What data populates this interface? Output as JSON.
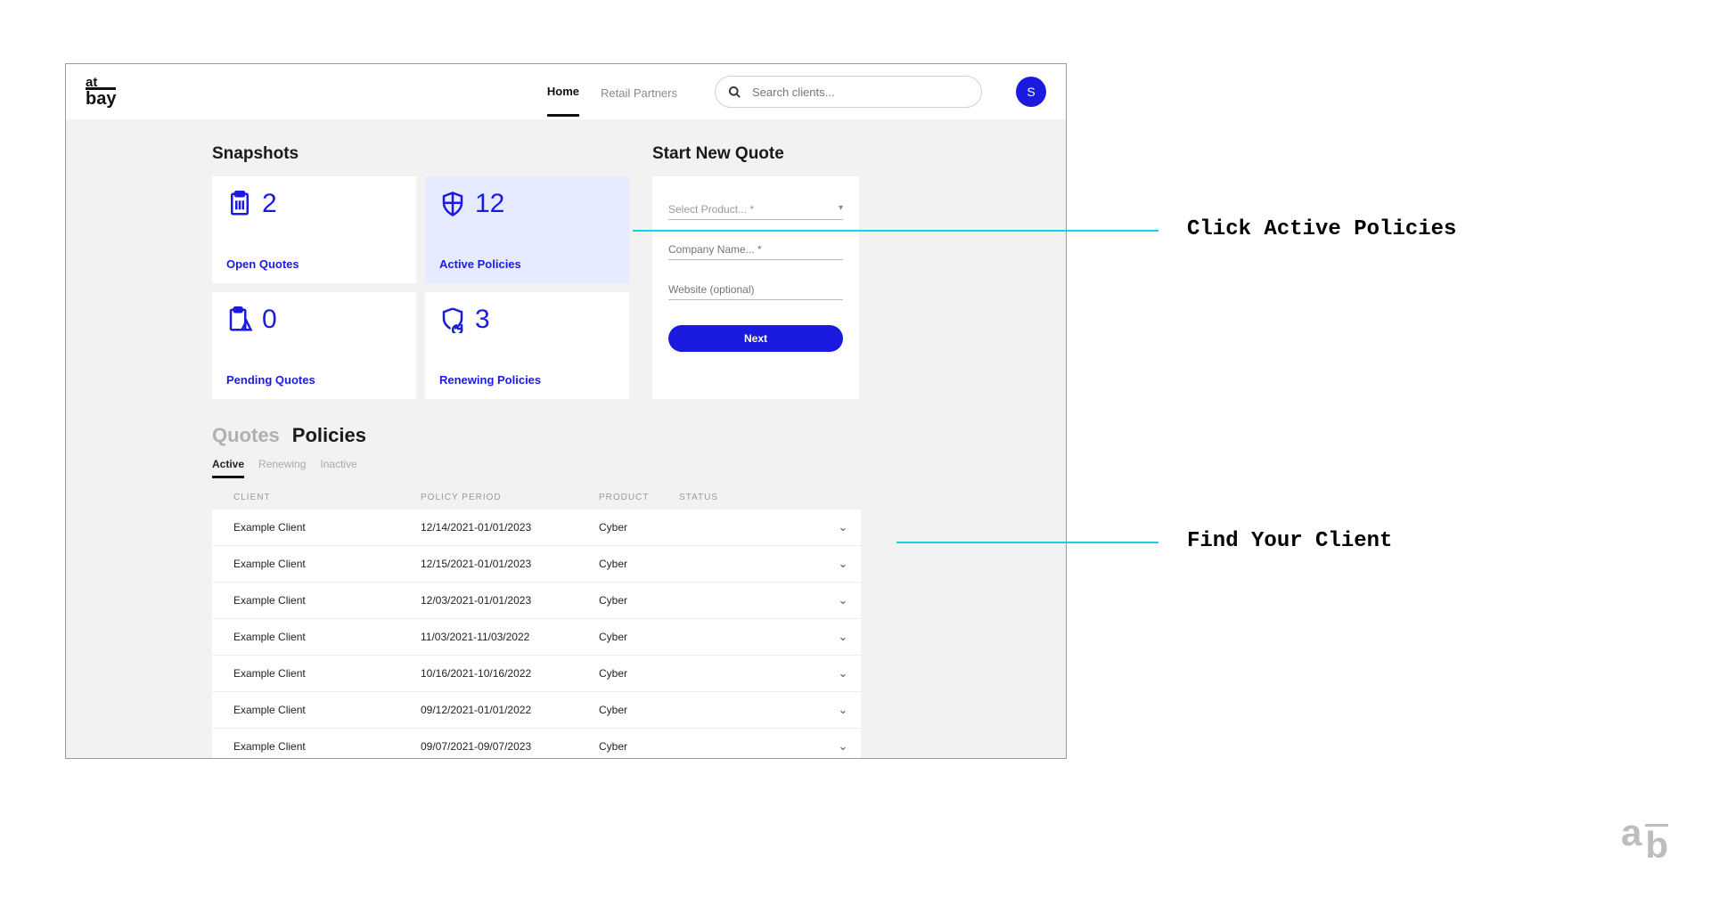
{
  "logo": {
    "top": "at",
    "bottom": "bay"
  },
  "nav": {
    "home": "Home",
    "retail": "Retail Partners"
  },
  "search": {
    "placeholder": "Search clients..."
  },
  "avatar": {
    "initial": "S"
  },
  "snapshots": {
    "title": "Snapshots",
    "cards": [
      {
        "count": "2",
        "label": "Open Quotes"
      },
      {
        "count": "12",
        "label": "Active Policies"
      },
      {
        "count": "0",
        "label": "Pending Quotes"
      },
      {
        "count": "3",
        "label": "Renewing Policies"
      }
    ]
  },
  "newquote": {
    "title": "Start New Quote",
    "product_placeholder": "Select Product... *",
    "company_placeholder": "Company Name... *",
    "website_placeholder": "Website (optional)",
    "next": "Next"
  },
  "maintabs": {
    "quotes": "Quotes",
    "policies": "Policies"
  },
  "subtabs": {
    "active": "Active",
    "renewing": "Renewing",
    "inactive": "Inactive"
  },
  "table": {
    "headers": {
      "client": "CLIENT",
      "period": "POLICY PERIOD",
      "product": "PRODUCT",
      "status": "STATUS"
    },
    "rows": [
      {
        "client": "Example Client",
        "period": "12/14/2021-01/01/2023",
        "product": "Cyber",
        "status": ""
      },
      {
        "client": "Example Client",
        "period": "12/15/2021-01/01/2023",
        "product": "Cyber",
        "status": ""
      },
      {
        "client": "Example Client",
        "period": "12/03/2021-01/01/2023",
        "product": "Cyber",
        "status": ""
      },
      {
        "client": "Example Client",
        "period": "11/03/2021-11/03/2022",
        "product": "Cyber",
        "status": ""
      },
      {
        "client": "Example Client",
        "period": "10/16/2021-10/16/2022",
        "product": "Cyber",
        "status": ""
      },
      {
        "client": "Example Client",
        "period": "09/12/2021-01/01/2022",
        "product": "Cyber",
        "status": ""
      },
      {
        "client": "Example Client",
        "period": "09/07/2021-09/07/2023",
        "product": "Cyber",
        "status": ""
      }
    ]
  },
  "callouts": {
    "a": "Click Active Policies",
    "b": "Find Your Client"
  },
  "watermark": {
    "a": "a",
    "b": "b"
  }
}
